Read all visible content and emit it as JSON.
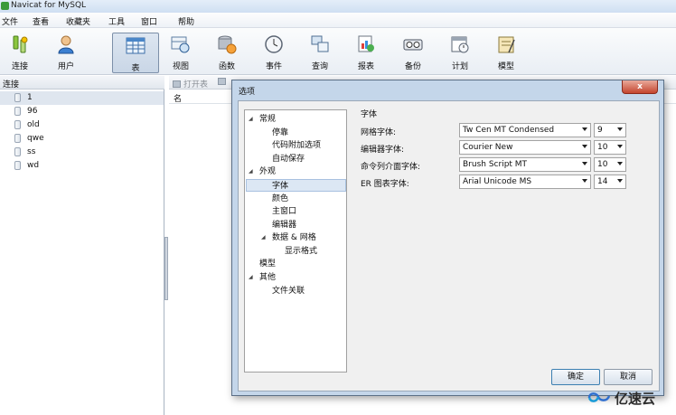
{
  "window": {
    "title": "Navicat for MySQL"
  },
  "menu": [
    "文件",
    "查看",
    "收藏夹",
    "工具",
    "窗口",
    "帮助"
  ],
  "toolbar": [
    {
      "label": "连接",
      "icon": "connection-icon"
    },
    {
      "label": "用户",
      "icon": "user-icon"
    },
    {
      "label": "表",
      "icon": "table-icon",
      "active": true
    },
    {
      "label": "视图",
      "icon": "view-icon"
    },
    {
      "label": "函数",
      "icon": "function-icon"
    },
    {
      "label": "事件",
      "icon": "event-icon"
    },
    {
      "label": "查询",
      "icon": "query-icon"
    },
    {
      "label": "报表",
      "icon": "report-icon"
    },
    {
      "label": "备份",
      "icon": "backup-icon"
    },
    {
      "label": "计划",
      "icon": "schedule-icon"
    },
    {
      "label": "模型",
      "icon": "model-icon"
    }
  ],
  "sidebar": {
    "header": "连接",
    "items": [
      "1",
      "96",
      "old",
      "qwe",
      "ss",
      "wd"
    ]
  },
  "objects": {
    "open_table": "打开表",
    "column_name": "名"
  },
  "dialog": {
    "title": "选项",
    "close": "x",
    "tree": [
      {
        "label": "常规",
        "level": 0,
        "expanded": true
      },
      {
        "label": "停靠",
        "level": 1
      },
      {
        "label": "代码附加选项",
        "level": 1
      },
      {
        "label": "自动保存",
        "level": 1
      },
      {
        "label": "外观",
        "level": 0,
        "expanded": true
      },
      {
        "label": "字体",
        "level": 1,
        "selected": true
      },
      {
        "label": "颜色",
        "level": 1
      },
      {
        "label": "主窗口",
        "level": 1
      },
      {
        "label": "编辑器",
        "level": 1
      },
      {
        "label": "数据 & 网格",
        "level": 1,
        "expanded": true
      },
      {
        "label": "显示格式",
        "level": 2
      },
      {
        "label": "模型",
        "level": 0
      },
      {
        "label": "其他",
        "level": 0,
        "expanded": true
      },
      {
        "label": "文件关联",
        "level": 1
      }
    ],
    "section_title": "字体",
    "fields": [
      {
        "label": "网格字体:",
        "font": "Tw Cen MT Condensed",
        "size": "9"
      },
      {
        "label": "编辑器字体:",
        "font": "Courier New",
        "size": "10"
      },
      {
        "label": "命令列介面字体:",
        "font": "Brush Script MT",
        "size": "10"
      },
      {
        "label": "ER 图表字体:",
        "font": "Arial Unicode MS",
        "size": "14"
      }
    ],
    "ok": "确定",
    "cancel": "取消"
  },
  "watermark": "亿速云",
  "colors": {
    "accent": "#3c7fb1",
    "selection": "#dce7f4",
    "close": "#c4452f"
  }
}
